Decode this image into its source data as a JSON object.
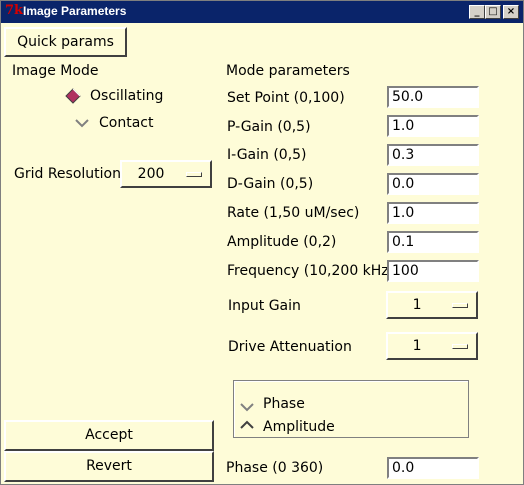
{
  "window": {
    "title": "Image Parameters",
    "icon": "tk-feather-icon",
    "controls": {
      "minimize": "_",
      "maximize": "□",
      "close": "×"
    }
  },
  "left": {
    "quick_params_label": "Quick params",
    "image_mode_label": "Image Mode",
    "modes": [
      {
        "label": "Oscillating",
        "selected": true
      },
      {
        "label": "Contact",
        "selected": false
      }
    ],
    "grid_resolution_label": "Grid Resolution",
    "grid_resolution_value": "200",
    "accept_label": "Accept",
    "revert_label": "Revert"
  },
  "right": {
    "section_label": "Mode parameters",
    "params": [
      {
        "label": "Set Point (0,100)",
        "value": "50.0"
      },
      {
        "label": "P-Gain (0,5)",
        "value": "1.0"
      },
      {
        "label": "I-Gain (0,5)",
        "value": "0.3"
      },
      {
        "label": "D-Gain (0,5)",
        "value": "0.0"
      },
      {
        "label": "Rate (1,50 uM/sec)",
        "value": "1.0"
      },
      {
        "label": "Amplitude (0,2)",
        "value": "0.1"
      },
      {
        "label": "Frequency (10,200 kHz)",
        "value": "100"
      }
    ],
    "input_gain_label": "Input Gain",
    "input_gain_value": "1",
    "drive_attenuation_label": "Drive Attenuation",
    "drive_attenuation_value": "1",
    "signal_options": [
      {
        "label": "Phase",
        "selected": false
      },
      {
        "label": "Amplitude",
        "selected": true
      }
    ],
    "phase_label": "Phase (0 360)",
    "phase_value": "0.0"
  }
}
